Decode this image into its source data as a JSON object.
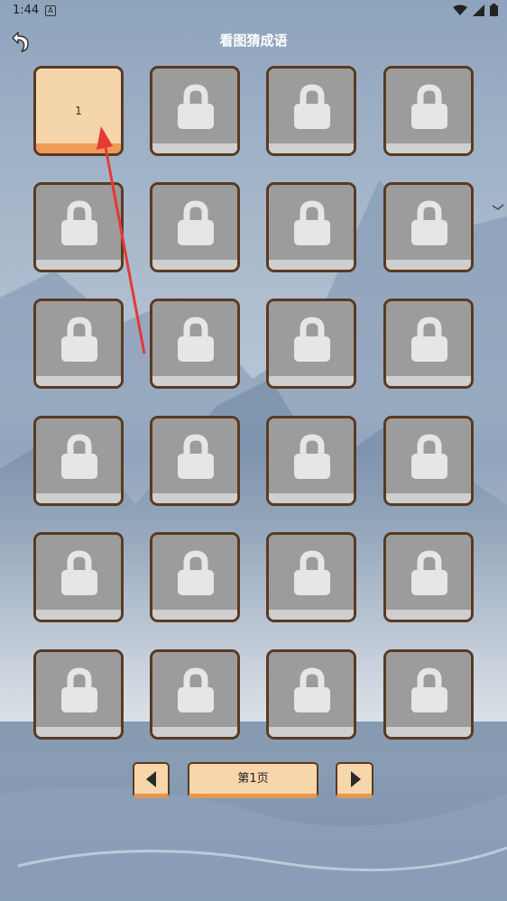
{
  "status_bar": {
    "time": "1:44",
    "notification_icon": "A"
  },
  "header": {
    "title": "看图猜成语",
    "back_icon": "undo-arrow-icon"
  },
  "levels": [
    {
      "label": "1",
      "state": "unlocked"
    },
    {
      "label": "",
      "state": "locked"
    },
    {
      "label": "",
      "state": "locked"
    },
    {
      "label": "",
      "state": "locked"
    },
    {
      "label": "",
      "state": "locked"
    },
    {
      "label": "",
      "state": "locked"
    },
    {
      "label": "",
      "state": "locked"
    },
    {
      "label": "",
      "state": "locked"
    },
    {
      "label": "",
      "state": "locked"
    },
    {
      "label": "",
      "state": "locked"
    },
    {
      "label": "",
      "state": "locked"
    },
    {
      "label": "",
      "state": "locked"
    },
    {
      "label": "",
      "state": "locked"
    },
    {
      "label": "",
      "state": "locked"
    },
    {
      "label": "",
      "state": "locked"
    },
    {
      "label": "",
      "state": "locked"
    },
    {
      "label": "",
      "state": "locked"
    },
    {
      "label": "",
      "state": "locked"
    },
    {
      "label": "",
      "state": "locked"
    },
    {
      "label": "",
      "state": "locked"
    },
    {
      "label": "",
      "state": "locked"
    },
    {
      "label": "",
      "state": "locked"
    },
    {
      "label": "",
      "state": "locked"
    },
    {
      "label": "",
      "state": "locked"
    }
  ],
  "pager": {
    "page_label": "第1页",
    "prev_icon": "triangle-left-icon",
    "next_icon": "triangle-right-icon"
  },
  "colors": {
    "unlocked_face": "#f5d6aa",
    "unlocked_base": "#ef9a55",
    "locked_face": "#9c9c9c",
    "border": "#5a3a22",
    "annotation_arrow": "#e53935"
  }
}
